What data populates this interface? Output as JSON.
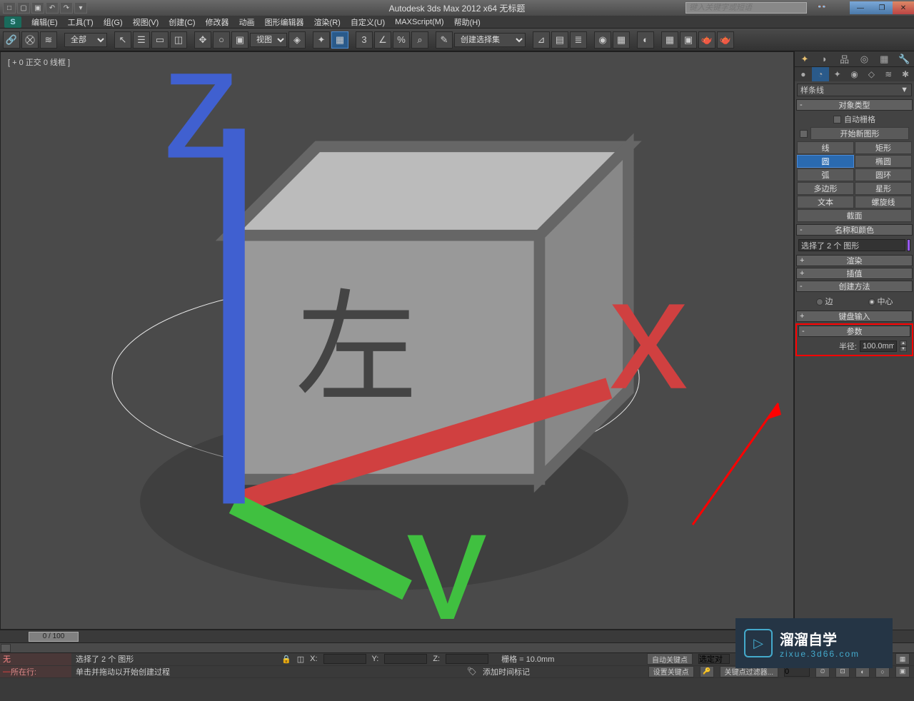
{
  "titlebar": {
    "title": "Autodesk 3ds Max  2012 x64     无标题",
    "search_placeholder": "键入关键字或短语"
  },
  "menu": {
    "items": [
      "编辑(E)",
      "工具(T)",
      "组(G)",
      "视图(V)",
      "创建(C)",
      "修改器",
      "动画",
      "图形编辑器",
      "渲染(R)",
      "自定义(U)",
      "MAXScript(M)",
      "帮助(H)"
    ]
  },
  "toolbar": {
    "filter_dd": "全部",
    "view_dd": "视图",
    "selset_dd": "创建选择集"
  },
  "viewport": {
    "label": "[ + 0 正交 0 线框 ]"
  },
  "cmdpanel": {
    "dropdown": "样条线",
    "rollout_objtype": {
      "title": "对象类型",
      "autogrid": "自动栅格",
      "startnew": "开始新图形"
    },
    "shapes": {
      "line": "线",
      "rect": "矩形",
      "circle": "圆",
      "ellipse": "椭圆",
      "arc": "弧",
      "donut": "圆环",
      "ngon": "多边形",
      "star": "星形",
      "text": "文本",
      "helix": "螺旋线",
      "section": "截面"
    },
    "rollout_name": {
      "title": "名称和颜色",
      "name": "选择了 2 个 图形"
    },
    "rollout_render": {
      "title": "渲染"
    },
    "rollout_interp": {
      "title": "插值"
    },
    "rollout_method": {
      "title": "创建方法",
      "edge": "边",
      "center": "中心"
    },
    "rollout_kbd": {
      "title": "键盘输入"
    },
    "rollout_params": {
      "title": "参数",
      "radius_label": "半径:",
      "radius_value": "100.0mm"
    }
  },
  "timeline": {
    "slider": "0 / 100"
  },
  "status": {
    "none_label": "无",
    "loc_label": "所在行:",
    "sel_text": "选择了 2 个 图形",
    "prompt": "单击并拖动以开始创建过程",
    "x": "X:",
    "y": "Y:",
    "z": "Z:",
    "grid": "栅格 = 10.0mm",
    "addtime": "添加时间标记",
    "autokey": "自动关键点",
    "setkey": "设置关键点",
    "selobj": "选定对",
    "keyfilter": "关键点过滤器..."
  },
  "watermark": {
    "t1": "溜溜自学",
    "t2": "zixue.3d66.com"
  }
}
